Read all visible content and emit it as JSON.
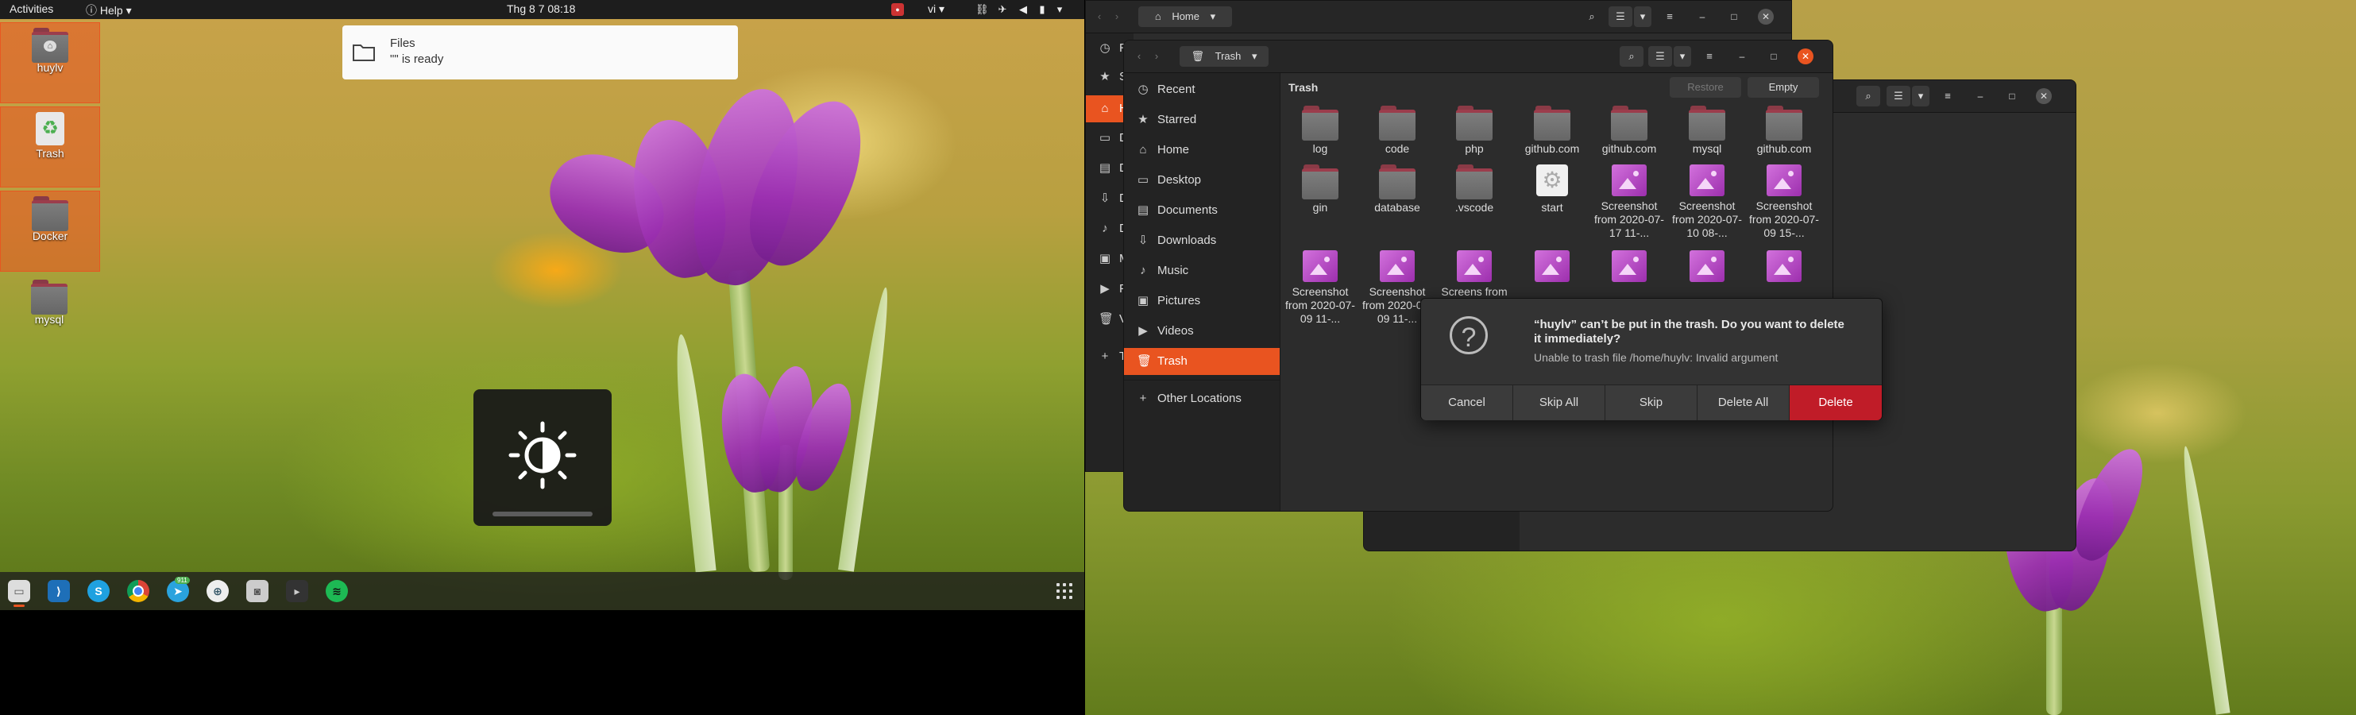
{
  "topbar": {
    "activities": "Activities",
    "help_menu": "Help",
    "clock": "Thg 8 7  08:18",
    "input_method": "vi"
  },
  "desktop": {
    "icons": [
      {
        "label": "huylv"
      },
      {
        "label": "Trash"
      },
      {
        "label": "Docker"
      },
      {
        "label": "mysql"
      }
    ]
  },
  "notification": {
    "title": "Files",
    "body": "\"\" is ready"
  },
  "dock": {
    "apps": [
      "files",
      "vscode",
      "skype",
      "chrome",
      "telegram",
      "app",
      "screenshot",
      "terminal",
      "spotify"
    ],
    "telegram_badge": "911"
  },
  "back_window": {
    "location": "Home",
    "sidebar_letters": [
      "R",
      "S",
      "H",
      "D",
      "D",
      "D",
      "D",
      "M",
      "P",
      "V",
      "T",
      "O"
    ]
  },
  "front_window": {
    "location": "Trash",
    "header_title": "Trash",
    "restore_label": "Restore",
    "empty_label": "Empty",
    "sidebar": [
      {
        "label": "Recent",
        "icon": "clock-icon"
      },
      {
        "label": "Starred",
        "icon": "star-icon"
      },
      {
        "label": "Home",
        "icon": "home-icon"
      },
      {
        "label": "Desktop",
        "icon": "desktop-icon"
      },
      {
        "label": "Documents",
        "icon": "document-icon"
      },
      {
        "label": "Downloads",
        "icon": "download-icon"
      },
      {
        "label": "Music",
        "icon": "music-icon"
      },
      {
        "label": "Pictures",
        "icon": "picture-icon"
      },
      {
        "label": "Videos",
        "icon": "video-icon"
      },
      {
        "label": "Trash",
        "icon": "trash-icon"
      },
      {
        "label": "Other Locations",
        "icon": "plus-icon"
      }
    ],
    "files": [
      {
        "name": "log",
        "type": "folder"
      },
      {
        "name": "code",
        "type": "folder"
      },
      {
        "name": "php",
        "type": "folder"
      },
      {
        "name": "github.com",
        "type": "folder"
      },
      {
        "name": "github.com",
        "type": "folder"
      },
      {
        "name": "mysql",
        "type": "folder"
      },
      {
        "name": "github.com",
        "type": "folder"
      },
      {
        "name": "gin",
        "type": "folder"
      },
      {
        "name": "database",
        "type": "folder"
      },
      {
        "name": ".vscode",
        "type": "folder"
      },
      {
        "name": "start",
        "type": "executable"
      },
      {
        "name": "Screenshot from 2020-07-17 11-...",
        "type": "image"
      },
      {
        "name": "Screenshot from 2020-07-10 08-...",
        "type": "image"
      },
      {
        "name": "Screenshot from 2020-07-09 15-...",
        "type": "image"
      },
      {
        "name": "Screenshot from 2020-07-09 11-...",
        "type": "image"
      },
      {
        "name": "Screenshot from 2020-07-09 11-...",
        "type": "image"
      },
      {
        "name": "Screens from 20 07-08 1...",
        "type": "image"
      },
      {
        "name": "",
        "type": "image"
      },
      {
        "name": "",
        "type": "image"
      },
      {
        "name": "",
        "type": "image"
      },
      {
        "name": "",
        "type": "image"
      }
    ]
  },
  "dialog": {
    "title": "“huylv” can’t be put in the trash. Do you want to delete it immediately?",
    "message": "Unable to trash file /home/huylv: Invalid argument",
    "buttons": [
      "Cancel",
      "Skip All",
      "Skip",
      "Delete All",
      "Delete"
    ]
  },
  "colors": {
    "accent": "#e95420",
    "danger": "#c01c28",
    "window_bg": "#2c2c2c",
    "sidebar_bg": "#232323"
  }
}
